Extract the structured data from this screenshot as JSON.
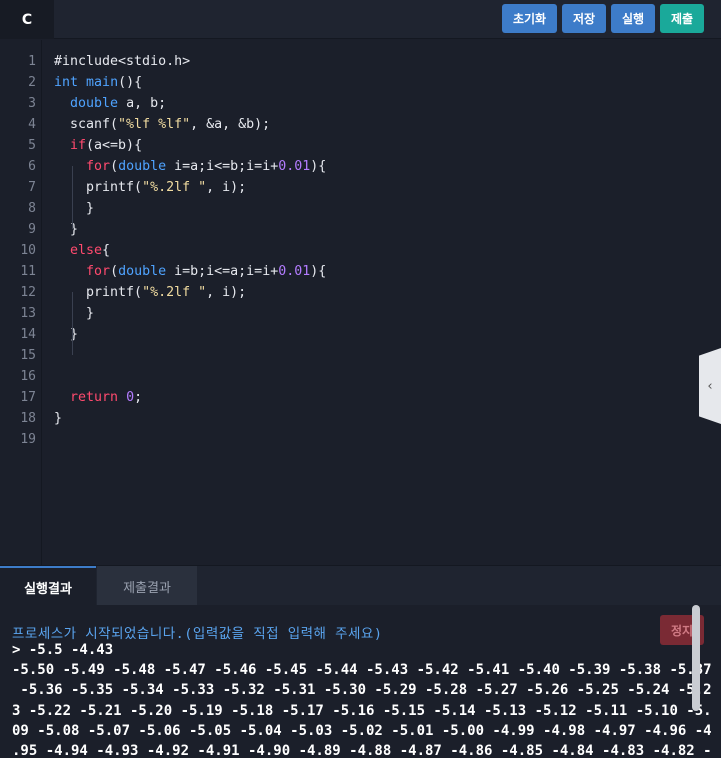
{
  "topbar": {
    "language": "C",
    "buttons": {
      "reset": "초기화",
      "save": "저장",
      "run": "실행",
      "submit": "제출"
    },
    "colors": {
      "primary": "#3d7cc9",
      "submit": "#1aa99a"
    }
  },
  "editor": {
    "line_numbers": [
      "1",
      "2",
      "3",
      "4",
      "5",
      "6",
      "7",
      "8",
      "9",
      "10",
      "11",
      "12",
      "13",
      "14",
      "15",
      "16",
      "17",
      "18",
      "19"
    ],
    "lines": [
      "#include<stdio.h>",
      "int main(){",
      "  double a, b;",
      "  scanf(\"%lf %lf\", &a, &b);",
      "  if(a<=b){",
      "    for(double i=a;i<=b;i=i+0.01){",
      "    printf(\"%.2lf \", i);",
      "    }",
      "  }",
      "  else{",
      "    for(double i=b;i<=a;i=i+0.01){",
      "    printf(\"%.2lf \", i);",
      "    }",
      "  }",
      "",
      "",
      "  return 0;",
      "}",
      ""
    ],
    "collapse_icon": "chevron-left-icon"
  },
  "result": {
    "tabs": {
      "output": "실행결과",
      "submission": "제출결과"
    },
    "stop_label": "정지",
    "start_message": "프로세스가 시작되었습니다.(입력값을 직접 입력해 주세요)",
    "input_line": "> -5.5 -4.43",
    "output_lines": [
      "-5.50 -5.49 -5.48 -5.47 -5.46 -5.45 -5.44 -5.43 -5.42 -5.41 -5.40 -5.39 -5.38 -5.37",
      " -5.36 -5.35 -5.34 -5.33 -5.32 -5.31 -5.30 -5.29 -5.28 -5.27 -5.26 -5.25 -5.24 -5.2",
      "3 -5.22 -5.21 -5.20 -5.19 -5.18 -5.17 -5.16 -5.15 -5.14 -5.13 -5.12 -5.11 -5.10 -5.",
      "09 -5.08 -5.07 -5.06 -5.05 -5.04 -5.03 -5.02 -5.01 -5.00 -4.99 -4.98 -4.97 -4.96 -4",
      ".95 -4.94 -4.93 -4.92 -4.91 -4.90 -4.89 -4.88 -4.87 -4.86 -4.85 -4.84 -4.83 -4.82 -"
    ]
  }
}
